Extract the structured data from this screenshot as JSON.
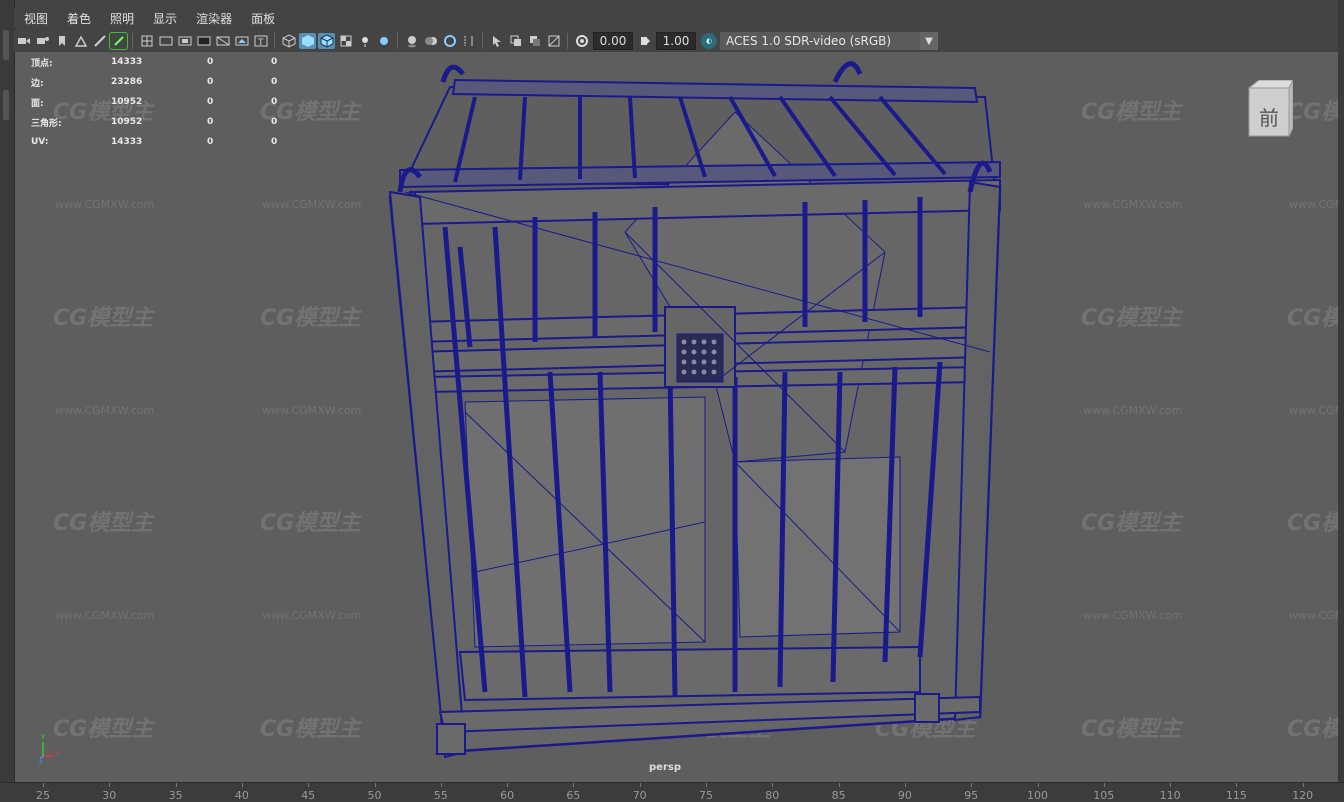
{
  "menu": [
    "视图",
    "着色",
    "照明",
    "显示",
    "渲染器",
    "面板"
  ],
  "toolbar": {
    "exposure_value": "0.00",
    "gamma_value": "1.00",
    "color_space": "ACES 1.0 SDR-video (sRGB)",
    "icons": [
      "camera-select-icon",
      "camera-attributes-icon",
      "bookmark-icon",
      "image-plane-icon",
      "grease-pencil-icon",
      "grid-icon",
      "film-gate-icon",
      "resolution-gate-icon",
      "gate-mask-icon",
      "field-chart-icon",
      "safe-action-icon",
      "safe-title-icon",
      "wireframe-icon",
      "smooth-shade-icon",
      "wireframe-on-shaded-icon",
      "textured-icon",
      "use-all-lights-icon",
      "shadows-icon",
      "screen-space-ao-icon",
      "motion-blur-icon",
      "anti-aliasing-icon",
      "depth-of-field-icon",
      "isolate-select-icon",
      "xray-icon",
      "xray-active-icon",
      "xray-joints-icon",
      "exposure-icon",
      "gamma-icon",
      "color-management-icon"
    ]
  },
  "hud": {
    "rows": [
      {
        "label": "顶点:",
        "v1": "14333",
        "v2": "0",
        "v3": "0"
      },
      {
        "label": "边:",
        "v1": "23286",
        "v2": "0",
        "v3": "0"
      },
      {
        "label": "面:",
        "v1": "10952",
        "v2": "0",
        "v3": "0"
      },
      {
        "label": "三角形:",
        "v1": "10952",
        "v2": "0",
        "v3": "0"
      },
      {
        "label": "UV:",
        "v1": "14333",
        "v2": "0",
        "v3": "0"
      }
    ]
  },
  "viewcube": {
    "label": "前"
  },
  "watermark": {
    "logo": "CG模型主",
    "url": "www.CGMXW.com"
  },
  "camera_label": "persp",
  "axis": {
    "x": "x",
    "y": "y",
    "z": "z"
  },
  "ruler": [
    "25",
    "30",
    "35",
    "40",
    "45",
    "50",
    "55",
    "60",
    "65",
    "70",
    "75",
    "80",
    "85",
    "90",
    "95",
    "100",
    "105",
    "110",
    "115",
    "120"
  ],
  "colors": {
    "wireframe": "#1a1a8c",
    "viewport_bg": "#5e5e5e",
    "mesh_fill": "#6a6a6a"
  }
}
